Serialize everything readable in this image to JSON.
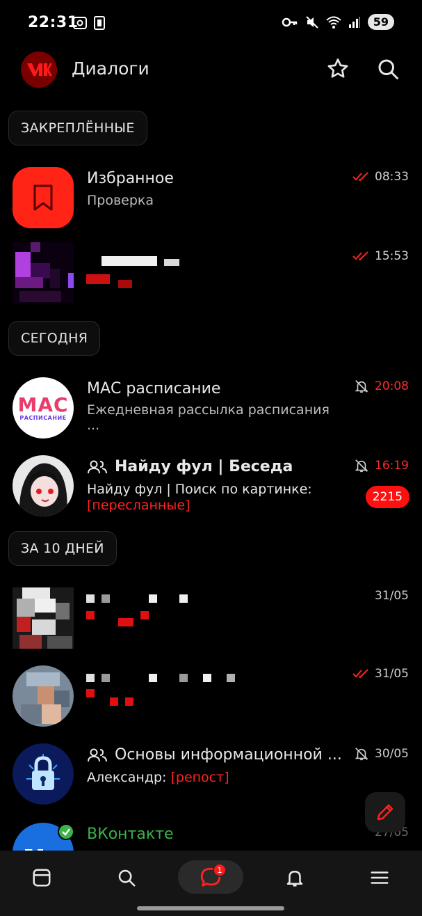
{
  "status_bar": {
    "time": "22:31",
    "battery": "59"
  },
  "header": {
    "title": "Диалоги"
  },
  "sections": {
    "pinned": "ЗАКРЕПЛЁННЫЕ",
    "today": "СЕГОДНЯ",
    "ten_days": "ЗА 10 ДНЕЙ"
  },
  "dialogs": [
    {
      "title": "Избранное",
      "subtitle": "Проверка",
      "time": "08:33"
    },
    {
      "title": "",
      "subtitle": "",
      "time": "15:53"
    },
    {
      "title": "МАС расписание",
      "subtitle": "Ежедневная рассылка расписания",
      "subtitle2": "...",
      "time": "20:08"
    },
    {
      "title": "Найду фул | Беседа",
      "subtitle": "Найду фул | Поиск по картинке:",
      "accent": "[пересланные]",
      "time": "16:19",
      "badge": "2215"
    },
    {
      "title": "",
      "subtitle": "",
      "time": "31/05"
    },
    {
      "title": "",
      "subtitle": "",
      "time": "31/05"
    },
    {
      "title": "Основы информационной ...",
      "subtitle": "Александр: ",
      "accent": "[репост]",
      "time": "30/05"
    },
    {
      "title": "ВКонтакте",
      "time": "27/05"
    }
  ],
  "avatars": {
    "mac_logo": "MAC",
    "mac_caption": "РАСПИСАНИЕ"
  },
  "nav": {
    "messages_badge": "1"
  },
  "colors": {
    "accent": "#ff1a1a",
    "vk_green": "#3ab34a",
    "background": "#000000"
  }
}
